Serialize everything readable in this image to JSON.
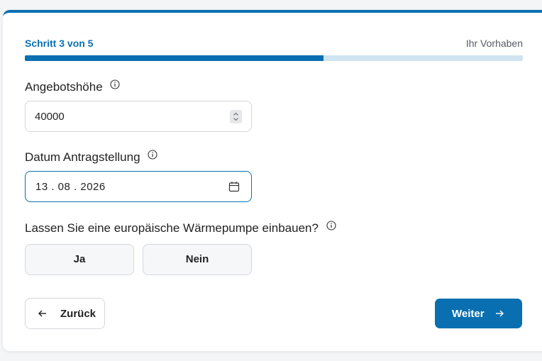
{
  "progress": {
    "step_label": "Schritt 3 von 5",
    "section_label": "Ihr Vorhaben",
    "fill_fraction": 0.6
  },
  "fields": {
    "offer_amount": {
      "label": "Angebotshöhe",
      "value": "40000"
    },
    "application_date": {
      "label": "Datum Antragstellung",
      "value": "13 . 08 . 2026"
    },
    "heat_pump_question": {
      "label": "Lassen Sie eine europäische Wärmepumpe einbauen?",
      "yes_label": "Ja",
      "no_label": "Nein"
    }
  },
  "nav": {
    "back_label": "Zurück",
    "next_label": "Weiter"
  },
  "colors": {
    "accent": "#0a6fb0",
    "progress_track": "#cfe3f1"
  }
}
